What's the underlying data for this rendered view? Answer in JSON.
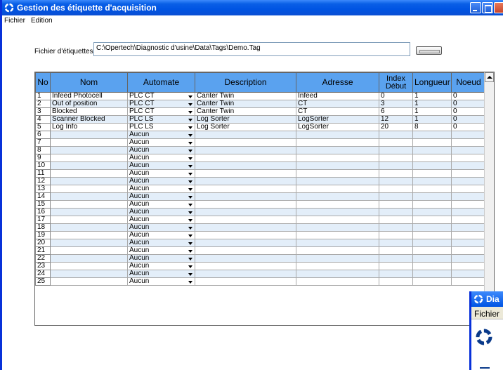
{
  "window": {
    "title": "Gestion des étiquette d'acquisition"
  },
  "menu": [
    "Fichier",
    "Edition"
  ],
  "file": {
    "label": "Fichier d'étiquettes",
    "path": "C:\\Opertech\\Diagnostic d'usine\\Data\\Tags\\Demo.Tag"
  },
  "table": {
    "columns": [
      "No",
      "Nom",
      "Automate",
      "Description",
      "Adresse",
      "Index Début",
      "Longueur",
      "Noeud"
    ],
    "rows": [
      [
        "1",
        "Infeed Photocell",
        "PLC CT",
        "Canter Twin",
        "Infeed",
        "0",
        "1",
        "0"
      ],
      [
        "2",
        "Out of position",
        "PLC CT",
        "Canter Twin",
        "CT",
        "3",
        "1",
        "0"
      ],
      [
        "3",
        "Blocked",
        "PLC CT",
        "Canter Twin",
        "CT",
        "6",
        "1",
        "0"
      ],
      [
        "4",
        "Scanner Blocked",
        "PLC LS",
        "Log Sorter",
        "LogSorter",
        "12",
        "1",
        "0"
      ],
      [
        "5",
        "Log Info",
        "PLC LS",
        "Log Sorter",
        "LogSorter",
        "20",
        "8",
        "0"
      ],
      [
        "6",
        "",
        "Aucun",
        "",
        "",
        "",
        "",
        ""
      ],
      [
        "7",
        "",
        "Aucun",
        "",
        "",
        "",
        "",
        ""
      ],
      [
        "8",
        "",
        "Aucun",
        "",
        "",
        "",
        "",
        ""
      ],
      [
        "9",
        "",
        "Aucun",
        "",
        "",
        "",
        "",
        ""
      ],
      [
        "10",
        "",
        "Aucun",
        "",
        "",
        "",
        "",
        ""
      ],
      [
        "11",
        "",
        "Aucun",
        "",
        "",
        "",
        "",
        ""
      ],
      [
        "12",
        "",
        "Aucun",
        "",
        "",
        "",
        "",
        ""
      ],
      [
        "13",
        "",
        "Aucun",
        "",
        "",
        "",
        "",
        ""
      ],
      [
        "14",
        "",
        "Aucun",
        "",
        "",
        "",
        "",
        ""
      ],
      [
        "15",
        "",
        "Aucun",
        "",
        "",
        "",
        "",
        ""
      ],
      [
        "16",
        "",
        "Aucun",
        "",
        "",
        "",
        "",
        ""
      ],
      [
        "17",
        "",
        "Aucun",
        "",
        "",
        "",
        "",
        ""
      ],
      [
        "18",
        "",
        "Aucun",
        "",
        "",
        "",
        "",
        ""
      ],
      [
        "19",
        "",
        "Aucun",
        "",
        "",
        "",
        "",
        ""
      ],
      [
        "20",
        "",
        "Aucun",
        "",
        "",
        "",
        "",
        ""
      ],
      [
        "21",
        "",
        "Aucun",
        "",
        "",
        "",
        "",
        ""
      ],
      [
        "22",
        "",
        "Aucun",
        "",
        "",
        "",
        "",
        ""
      ],
      [
        "23",
        "",
        "Aucun",
        "",
        "",
        "",
        "",
        ""
      ],
      [
        "24",
        "",
        "Aucun",
        "",
        "",
        "",
        "",
        ""
      ],
      [
        "25",
        "",
        "Aucun",
        "",
        "",
        "",
        "",
        ""
      ]
    ]
  },
  "second_window": {
    "title": "Dia",
    "menu": "Fichier"
  },
  "colors": {
    "titlebar": "#0054e3",
    "header": "#5aa2ef",
    "row_alt": "#e3eef9"
  }
}
